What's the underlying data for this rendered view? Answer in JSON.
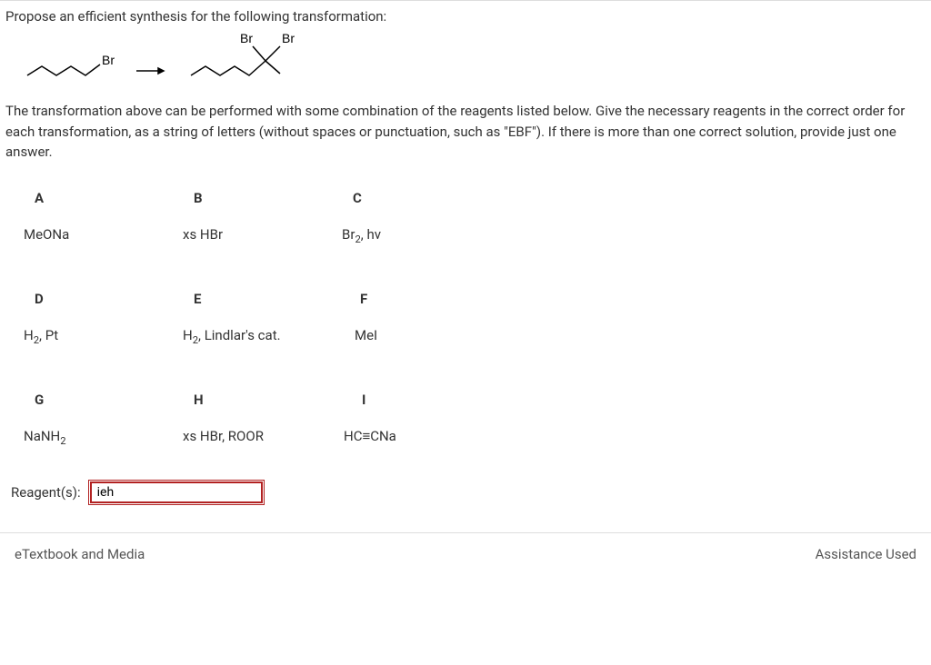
{
  "prompt": "Propose an efficient synthesis for the following transformation:",
  "structure": {
    "label_br": "Br",
    "label_br_left": "Br",
    "label_br_right": "Br"
  },
  "instruction": "The transformation above can be performed with some combination of the reagents listed below. Give the necessary reagents in the correct order for each transformation, as a string of letters (without spaces or punctuation, such as \"EBF\"). If there is more than one correct solution, provide just one answer.",
  "reagents": {
    "A": {
      "letter": "A",
      "value_html": "MeONa"
    },
    "B": {
      "letter": "B",
      "value_html": "xs HBr"
    },
    "C": {
      "letter": "C",
      "value_html": "Br<sub>2</sub>, hv"
    },
    "D": {
      "letter": "D",
      "value_html": "H<sub>2</sub>, Pt"
    },
    "E": {
      "letter": "E",
      "value_html": "H<sub>2</sub>, Lindlar's cat."
    },
    "F": {
      "letter": "F",
      "value_html": "MeI"
    },
    "G": {
      "letter": "G",
      "value_html": "NaNH<sub>2</sub>"
    },
    "H": {
      "letter": "H",
      "value_html": "xs HBr, ROOR"
    },
    "I": {
      "letter": "I",
      "value_html": "HC≡CNa"
    }
  },
  "answer": {
    "label": "Reagent(s):",
    "value": "ieh"
  },
  "footer": {
    "etextbook": "eTextbook and Media",
    "assistance": "Assistance Used"
  }
}
